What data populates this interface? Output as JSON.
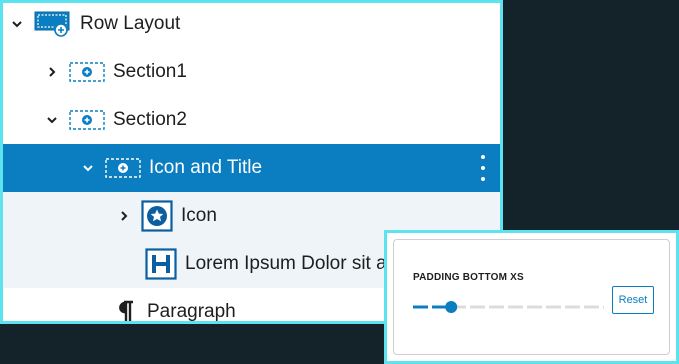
{
  "tree": {
    "items": [
      {
        "label": "Row Layout",
        "expanded": true,
        "icon": "row-layout-icon"
      },
      {
        "label": "Section1",
        "expanded": false,
        "icon": "section-icon"
      },
      {
        "label": "Section2",
        "expanded": true,
        "icon": "section-icon"
      },
      {
        "label": "Icon and Title",
        "expanded": true,
        "selected": true,
        "icon": "section-icon"
      },
      {
        "label": "Icon",
        "expanded": false,
        "icon": "star-icon"
      },
      {
        "label": "Lorem Ipsum Dolor sit a",
        "icon": "heading-icon"
      },
      {
        "label": "Paragraph",
        "icon": "paragraph-icon"
      }
    ]
  },
  "padding_control": {
    "title": "PADDING BOTTOM XS",
    "reset_label": "Reset",
    "slider_level": 0.2
  },
  "colors": {
    "accent": "#0b7ec1",
    "selection": "#0b7ec1",
    "highlight_border": "#5de3f0",
    "tinted_row": "#eef4f8",
    "background": "#14232a"
  }
}
